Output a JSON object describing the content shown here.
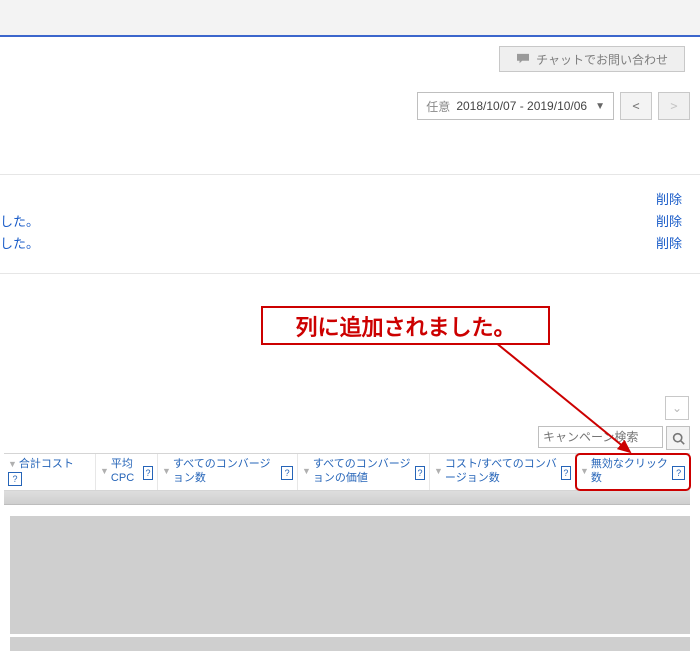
{
  "top": {
    "chat_button_label": "チャットでお問い合わせ"
  },
  "date_range": {
    "prefix_label": "任意",
    "range_text": "2018/10/07 - 2019/10/06"
  },
  "messages": {
    "rows": [
      {
        "text": "",
        "delete_label": "削除"
      },
      {
        "text": "した。",
        "delete_label": "削除"
      },
      {
        "text": "した。",
        "delete_label": "削除"
      }
    ]
  },
  "callout": {
    "text": "列に追加されました。"
  },
  "search": {
    "placeholder": "キャンペーン検索"
  },
  "columns": {
    "c0": "合計コスト",
    "c1": "平均CPC",
    "c2": "すべてのコンバージョン数",
    "c3": "すべてのコンバージョンの価値",
    "c4": "コスト/すべてのコンバージョン数",
    "c5": "無効なクリック数"
  }
}
